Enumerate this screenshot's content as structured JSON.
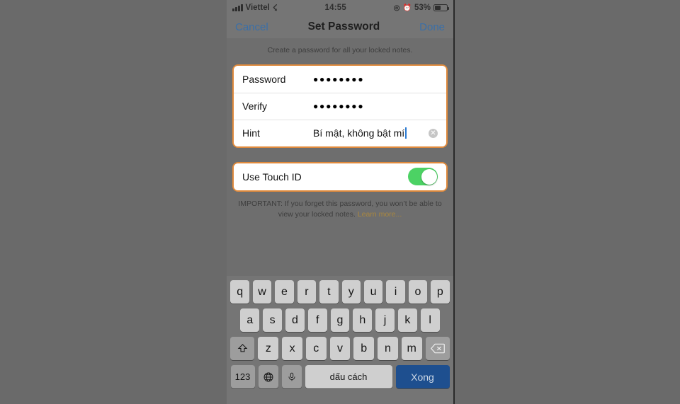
{
  "status_bar": {
    "carrier": "Viettel",
    "wifi_icon": "wifi-icon",
    "time": "14:55",
    "location_icon": "location-arrow-icon",
    "alarm_icon": "alarm-clock-icon",
    "battery_percent": "53%",
    "battery_level": 53
  },
  "nav": {
    "cancel_label": "Cancel",
    "title": "Set Password",
    "done_label": "Done",
    "link_color": "#3a6fa8"
  },
  "main": {
    "subtitle": "Create a password for all your locked notes.",
    "fields": [
      {
        "label": "Password",
        "value": "●●●●●●●●",
        "type": "password"
      },
      {
        "label": "Verify",
        "value": "●●●●●●●●",
        "type": "password"
      },
      {
        "label": "Hint",
        "value": "Bí mật, không bật mí",
        "type": "text"
      }
    ],
    "clear_icon": "✕",
    "touch_id": {
      "label": "Use Touch ID",
      "enabled": true,
      "on_color": "#4cd264"
    },
    "footnote_text": "IMPORTANT: If you forget this password, you won’t be able to view your locked notes. ",
    "learn_more_label": "Learn more...",
    "learn_more_color": "#a9873f",
    "highlight_color": "#e08a3c"
  },
  "keyboard": {
    "row1": [
      "q",
      "w",
      "e",
      "r",
      "t",
      "y",
      "u",
      "i",
      "o",
      "p"
    ],
    "row2": [
      "a",
      "s",
      "d",
      "f",
      "g",
      "h",
      "j",
      "k",
      "l"
    ],
    "row3": [
      "z",
      "x",
      "c",
      "v",
      "b",
      "n",
      "m"
    ],
    "shift_icon": "shift-arrow-icon",
    "backspace_icon": "backspace-icon",
    "numbers_label": "123",
    "globe_icon": "globe-icon",
    "mic_icon": "microphone-icon",
    "space_label": "dấu cách",
    "done_label": "Xong",
    "done_color": "#1e4f8f"
  }
}
